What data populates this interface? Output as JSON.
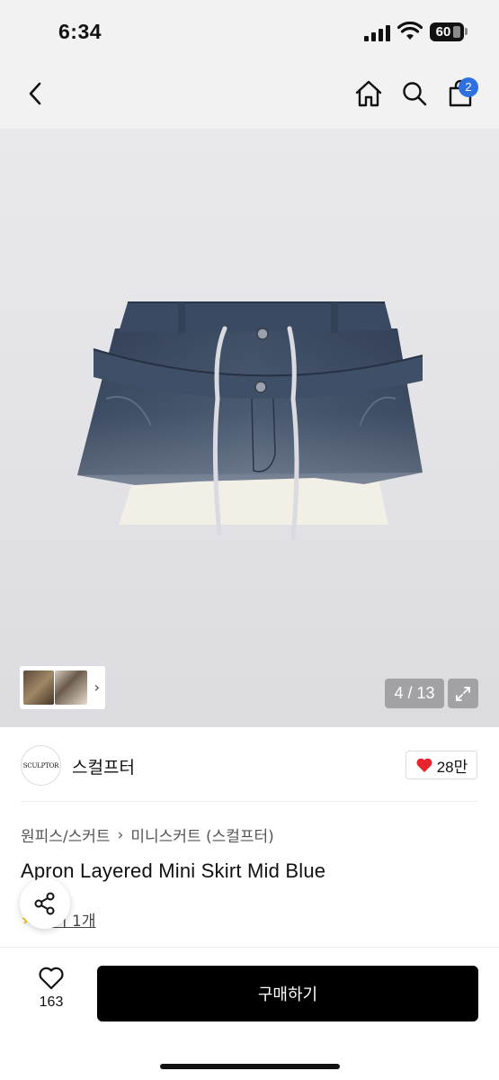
{
  "status_bar": {
    "time": "6:34",
    "battery": "60"
  },
  "nav": {
    "cart_count": "2"
  },
  "gallery": {
    "counter": "4 / 13"
  },
  "brand": {
    "logo_text": "SCULPTOR",
    "name": "스컬프터",
    "likes": "28만"
  },
  "breadcrumb": {
    "category": "원피스/스커트",
    "subcategory": "미니스커트 (스컬프터)"
  },
  "product": {
    "title": "Apron Layered Mini Skirt Mid Blue",
    "review_text": "후기 1개"
  },
  "bottom": {
    "wish_count": "163",
    "buy_label": "구매하기"
  },
  "colors": {
    "badge": "#2f6fe0",
    "heart": "#e8242f",
    "buy_button": "#000000",
    "denim": "#3c4a5e"
  }
}
